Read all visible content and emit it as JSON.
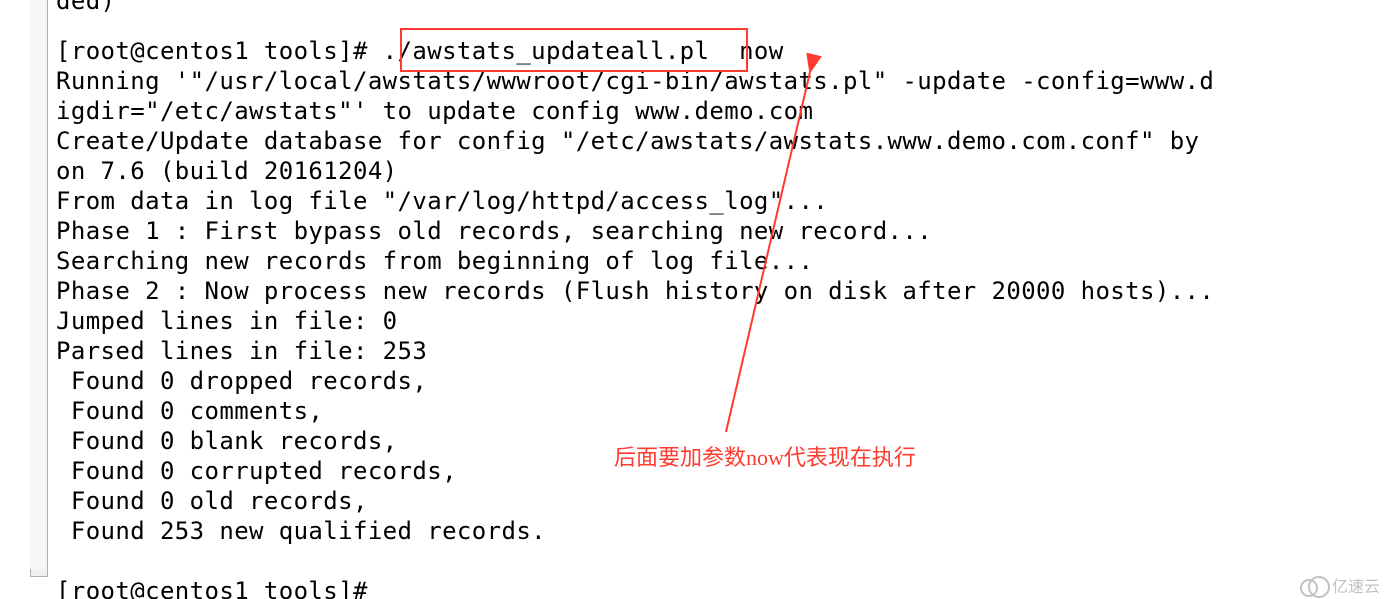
{
  "ruler": {
    "faded_text": "ded)"
  },
  "terminal": {
    "lines": [
      "[root@centos1 tools]# ./awstats_updateall.pl  now",
      "Running '\"/usr/local/awstats/wwwroot/cgi-bin/awstats.pl\" -update -config=www.d",
      "igdir=\"/etc/awstats\"' to update config www.demo.com",
      "Create/Update database for config \"/etc/awstats/awstats.www.demo.com.conf\" by ",
      "on 7.6 (build 20161204)",
      "From data in log file \"/var/log/httpd/access_log\"...",
      "Phase 1 : First bypass old records, searching new record...",
      "Searching new records from beginning of log file...",
      "Phase 2 : Now process new records (Flush history on disk after 20000 hosts)...",
      "Jumped lines in file: 0",
      "Parsed lines in file: 253",
      " Found 0 dropped records,",
      " Found 0 comments,",
      " Found 0 blank records,",
      " Found 0 corrupted records,",
      " Found 0 old records,",
      " Found 253 new qualified records.",
      "",
      "[root@centos1 tools]# "
    ]
  },
  "annotation": {
    "note": "后面要加参数now代表现在执行"
  },
  "watermark": {
    "text": "亿速云"
  }
}
